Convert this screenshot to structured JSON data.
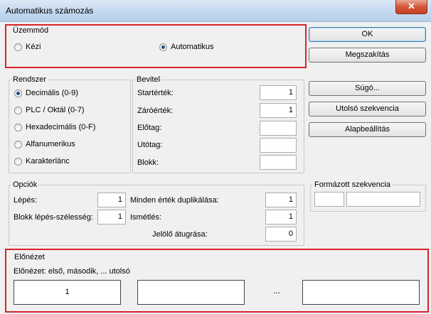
{
  "window": {
    "title": "Automatikus számozás",
    "close_glyph": "✕"
  },
  "mode": {
    "label": "Üzemmód",
    "options": [
      "Kézi",
      "Automatikus"
    ],
    "selected": "Automatikus"
  },
  "buttons": {
    "ok": "OK",
    "cancel": "Megszakítás",
    "help": "Súgó...",
    "last_sequence": "Utolsó szekvencia",
    "defaults": "Alapbeállítás"
  },
  "system": {
    "label": "Rendszer",
    "options": [
      "Decimális (0-9)",
      "PLC / Oktál (0-7)",
      "Hexadecimális (0-F)",
      "Alfanumerikus",
      "Karakterlánc"
    ],
    "selected": "Decimális (0-9)"
  },
  "input": {
    "label": "Bevitel",
    "fields": [
      {
        "label": "Startérték:",
        "value": "1"
      },
      {
        "label": "Záróérték:",
        "value": "1"
      },
      {
        "label": "Előtag:",
        "value": ""
      },
      {
        "label": "Utótag:",
        "value": ""
      },
      {
        "label": "Blokk:",
        "value": ""
      }
    ]
  },
  "options": {
    "label": "Opciók",
    "left": [
      {
        "label": "Lépés:",
        "value": "1"
      },
      {
        "label": "Blokk lépés-szélesség:",
        "value": "1"
      }
    ],
    "right": [
      {
        "label": "Minden érték duplikálása:",
        "value": "1"
      },
      {
        "label": "Ismétlés:",
        "value": "1"
      },
      {
        "label": "Jelölő átugrása:",
        "value": "0"
      }
    ]
  },
  "formatted": {
    "label": "Formázott szekvencia"
  },
  "preview": {
    "label": "Előnézet",
    "caption": "Előnézet: első, második, ... utolsó",
    "boxes": [
      "1",
      "",
      "...",
      ""
    ]
  },
  "colors": {
    "highlight": "#d6232a",
    "accent": "#1d4f8a"
  }
}
